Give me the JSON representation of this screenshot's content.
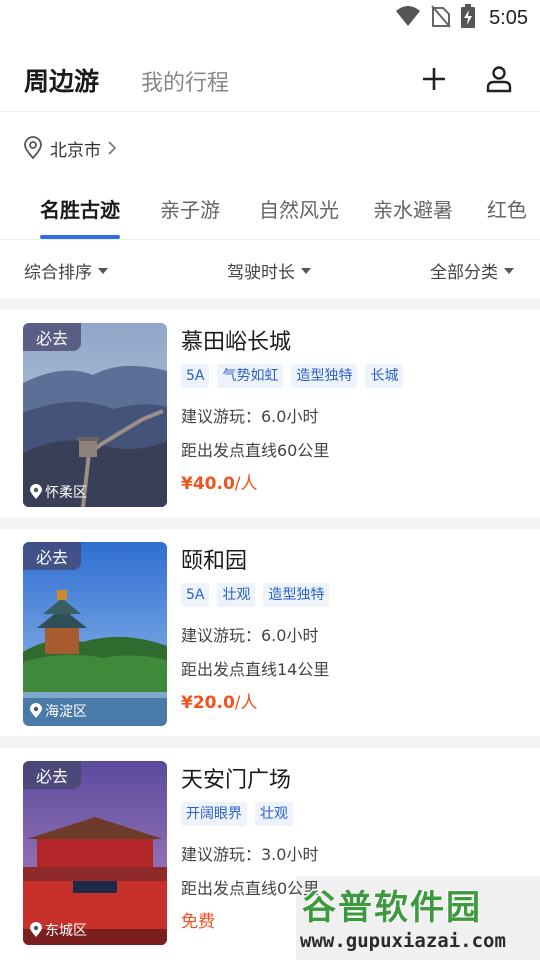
{
  "status": {
    "time": "5:05"
  },
  "header": {
    "tab_main": "周边游",
    "tab_sub": "我的行程"
  },
  "location": {
    "city": "北京市"
  },
  "categories": [
    "名胜古迹",
    "亲子游",
    "自然风光",
    "亲水避暑",
    "红色"
  ],
  "filters": [
    "综合排序",
    "驾驶时长",
    "全部分类"
  ],
  "must_go_label": "必去",
  "places": [
    {
      "name": "慕田峪长城",
      "tags": [
        "5A",
        "气势如虹",
        "造型独特",
        "长城"
      ],
      "duration": "建议游玩：6.0小时",
      "distance": "距出发点直线60公里",
      "price_value": "¥40.0",
      "price_unit": "/人",
      "district": "怀柔区"
    },
    {
      "name": "颐和园",
      "tags": [
        "5A",
        "壮观",
        "造型独特"
      ],
      "duration": "建议游玩：6.0小时",
      "distance": "距出发点直线14公里",
      "price_value": "¥20.0",
      "price_unit": "/人",
      "district": "海淀区"
    },
    {
      "name": "天安门广场",
      "tags": [
        "开阔眼界",
        "壮观"
      ],
      "duration": "建议游玩：3.0小时",
      "distance": "距出发点直线0公里",
      "price_value": "免费",
      "price_unit": "",
      "district": "东城区"
    }
  ],
  "watermark": {
    "text": "谷普软件园",
    "url": "www.gupuxiazai.com"
  },
  "colors": {
    "accent": "#2f6fde",
    "price": "#f0531e",
    "tag_text": "#2a62c9",
    "tag_bg": "#eef3fb"
  }
}
